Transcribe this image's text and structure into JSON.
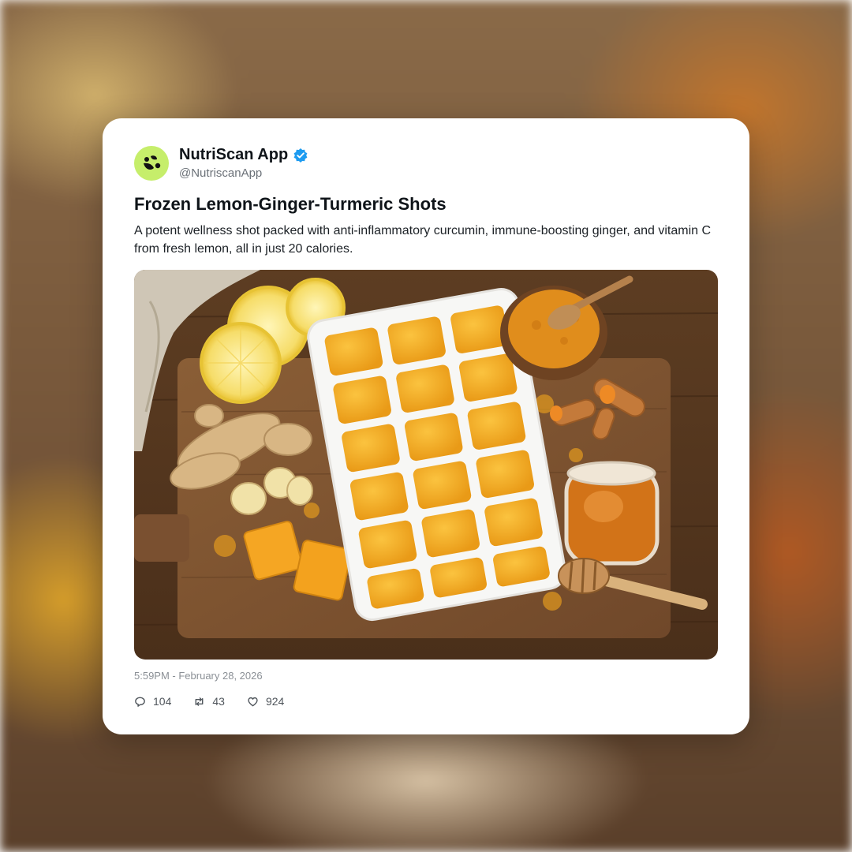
{
  "post": {
    "account": {
      "name": "NutriScan App",
      "handle": "@NutriscanApp",
      "verified": true,
      "avatar_color": "#c6ee6b",
      "verified_color": "#1d9bf0"
    },
    "title": "Frozen Lemon-Ginger-Turmeric Shots",
    "body": "A potent wellness shot packed with anti-inflammatory curcumin, immune-boosting ginger, and vitamin C from fresh lemon, all in just 20 calories.",
    "timestamp": "5:59PM - February 28, 2026",
    "stats": {
      "replies": "104",
      "reposts": "43",
      "likes": "924"
    },
    "icons": {
      "reply": "speech-bubble-icon",
      "repost": "repost-icon",
      "like": "heart-icon"
    }
  }
}
